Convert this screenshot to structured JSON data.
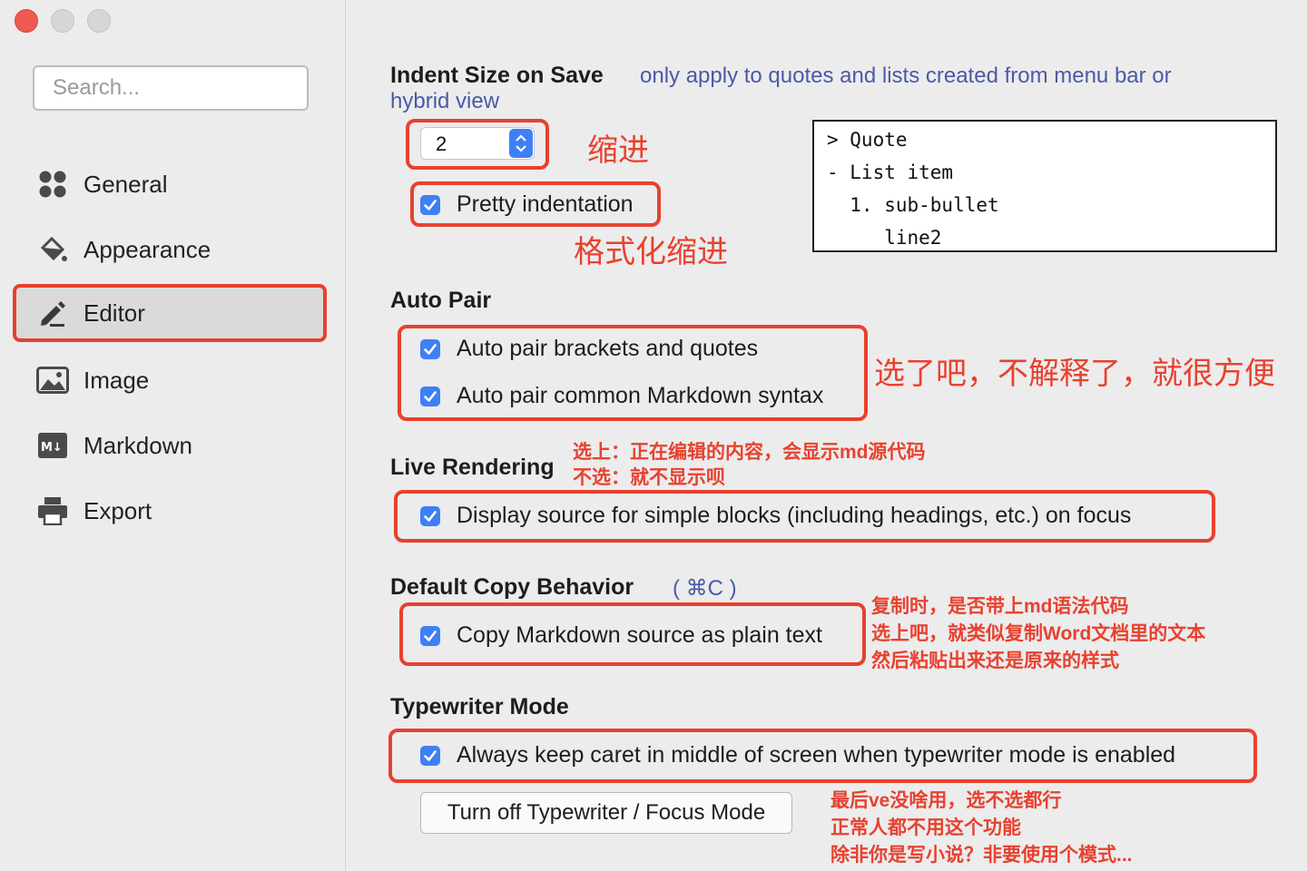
{
  "sidebar": {
    "search_placeholder": "Search...",
    "items": [
      {
        "label": "General",
        "icon": "grid-icon"
      },
      {
        "label": "Appearance",
        "icon": "paint-bucket-icon"
      },
      {
        "label": "Editor",
        "icon": "pencil-icon"
      },
      {
        "label": "Image",
        "icon": "image-icon"
      },
      {
        "label": "Markdown",
        "icon": "markdown-icon"
      },
      {
        "label": "Export",
        "icon": "printer-icon"
      }
    ],
    "active": "Editor"
  },
  "indent": {
    "heading": "Indent Size on Save",
    "hint_line1": "only apply to quotes and lists created from menu bar or",
    "hint_line2": "hybrid view",
    "value": "2",
    "pretty_label": "Pretty indentation",
    "annotation_indent": "缩进",
    "annotation_pretty": "格式化缩进",
    "preview": [
      "> Quote",
      "- List item",
      "  1. sub-bullet",
      "     line2"
    ]
  },
  "auto_pair": {
    "heading": "Auto Pair",
    "opt1": "Auto pair brackets and quotes",
    "opt2": "Auto pair common Markdown syntax",
    "annotation": "选了吧，不解释了，就很方便"
  },
  "live_rendering": {
    "heading": "Live Rendering",
    "opt": "Display source for simple blocks (including headings, etc.) on focus",
    "annotation_line1": "选上：正在编辑的内容，会显示md源代码",
    "annotation_line2": "不选：就不显示呗"
  },
  "copy_behavior": {
    "heading": "Default Copy Behavior",
    "shortcut": "( ⌘C )",
    "opt": "Copy Markdown source as plain text",
    "annotation_line1": "复制时，是否带上md语法代码",
    "annotation_line2": "选上吧，就类似复制Word文档里的文本",
    "annotation_line3": "然后粘贴出来还是原来的样式"
  },
  "typewriter": {
    "heading": "Typewriter Mode",
    "opt": "Always keep caret in middle of screen when typewriter mode is enabled",
    "button": "Turn off Typewriter / Focus Mode",
    "annotation_line1": "最后ve没啥用，选不选都行",
    "annotation_line2": "正常人都不用这个功能",
    "annotation_line3": "除非你是写小说？非要使用个模式..."
  },
  "colors": {
    "accent": "#3f7ff6",
    "annotation_red": "#e8412f",
    "hint_blue": "#4a5aa8"
  }
}
